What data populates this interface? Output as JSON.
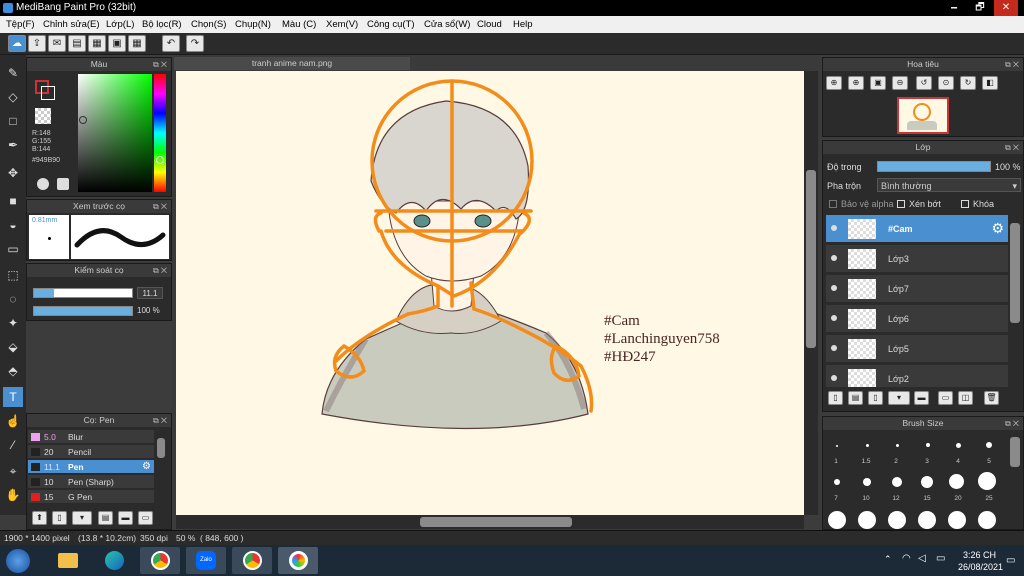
{
  "window": {
    "title": "MediBang Paint Pro (32bit)",
    "min": "🗕",
    "max": "🗗",
    "close": "✕"
  },
  "menu": [
    "Tệp(F)",
    "Chỉnh sửa(E)",
    "Lớp(L)",
    "Bộ lọc(R)",
    "Chọn(S)",
    "Chụp(N)",
    "Màu (C)",
    "Xem(V)",
    "Công cụ(T)",
    "Cửa sổ(W)",
    "Cloud",
    "Help"
  ],
  "color_panel": {
    "title": "Màu",
    "r": "R:148",
    "g": "G:155",
    "b": "B:144",
    "hex": "#949B90",
    "fg": "#949b90",
    "bg": "#5fc3a0"
  },
  "brush_preview": {
    "title": "Xem trước cọ",
    "size": "0.81mm"
  },
  "brush_control": {
    "title": "Kiểm soát cọ",
    "size_value": "11.1",
    "opacity_value": "100 %"
  },
  "brush_list": {
    "title": "Cọ: Pen",
    "items": [
      {
        "size": "5.0",
        "name": "Blur",
        "color": "#f0a0f0"
      },
      {
        "size": "20",
        "name": "Pencil",
        "color": "#222222"
      },
      {
        "size": "11.1",
        "name": "Pen",
        "color": "#222222"
      },
      {
        "size": "10",
        "name": "Pen (Sharp)",
        "color": "#222222"
      },
      {
        "size": "15",
        "name": "G Pen",
        "color": "#e02020"
      }
    ]
  },
  "document": {
    "tab": "tranh anime nam.png",
    "caption": [
      "#Cam",
      "#Lanchinguyen758",
      "#HĐ247"
    ]
  },
  "navigator": {
    "title": "Hoa tiêu"
  },
  "layers": {
    "title": "Lớp",
    "opacity_label": "Độ trong",
    "opacity_value": "100 %",
    "blend_label": "Pha trộn",
    "blend_value": "Bình thường",
    "alpha_protect": "Bảo vệ alpha",
    "clipping": "Xén bớt",
    "lock": "Khóa",
    "items": [
      "#Cam",
      "Lớp3",
      "Lớp7",
      "Lớp6",
      "Lớp5",
      "Lớp2"
    ]
  },
  "brush_size": {
    "title": "Brush Size",
    "row1": [
      "1",
      "1.5",
      "2",
      "3",
      "4",
      "5"
    ],
    "row2": [
      "7",
      "10",
      "12",
      "15",
      "20",
      "25"
    ]
  },
  "status": {
    "pixels": "1900 * 1400 pixel",
    "size": "(13.8 * 10.2cm)",
    "dpi": "350 dpi",
    "zoom": "50 %",
    "coords": "( 848, 600 )"
  },
  "taskbar": {
    "time": "3:26 CH",
    "date": "26/08/2021"
  }
}
